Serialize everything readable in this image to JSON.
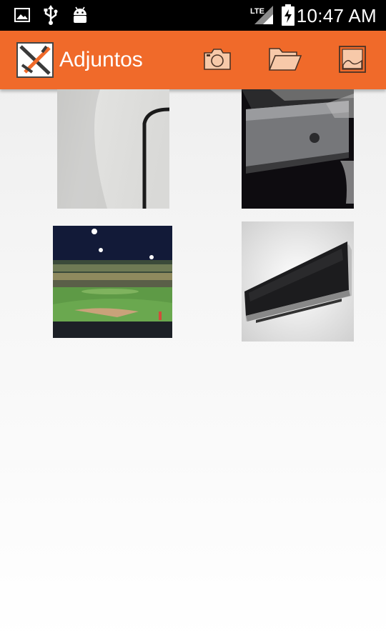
{
  "status_bar": {
    "time": "10:47 AM",
    "network_label": "LTE",
    "icons": [
      "image-icon",
      "usb-icon",
      "android-debug-icon",
      "lte-signal-icon",
      "battery-charging-icon"
    ]
  },
  "app_bar": {
    "title": "Adjuntos",
    "background_color": "#f06a2a",
    "actions": [
      {
        "name": "camera-icon",
        "label": ""
      },
      {
        "name": "folder-icon",
        "label": ""
      },
      {
        "name": "gallery-icon",
        "label": ""
      }
    ]
  },
  "attachments": [
    {
      "name": "attachment-wall-cable",
      "description": ""
    },
    {
      "name": "attachment-appliance-dark",
      "description": ""
    },
    {
      "name": "attachment-baseball-stadium",
      "description": ""
    },
    {
      "name": "attachment-air-conditioner",
      "description": ""
    }
  ]
}
